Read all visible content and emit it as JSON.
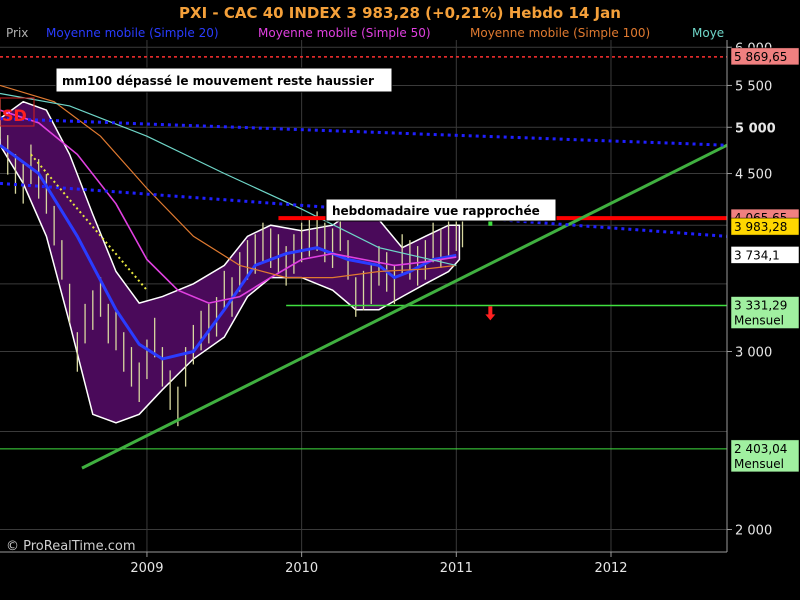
{
  "header": {
    "title": "PXI - CAC 40 INDEX     3 983,28 (+0,21%)     Hebdo  14 Jan"
  },
  "legend": [
    {
      "label": "Prix",
      "color": "#b0b0b0"
    },
    {
      "label": "Moyenne mobile (Simple 20)",
      "color": "#2a3cff"
    },
    {
      "label": "Moyenne mobile (Simple 50)",
      "color": "#e040e0"
    },
    {
      "label": "Moyenne mobile (Simple 100)",
      "color": "#e07a30"
    },
    {
      "label": "Moye",
      "color": "#6fd6c8"
    }
  ],
  "annotations": [
    {
      "text": "mm100 dépassé  le mouvement reste haussier"
    },
    {
      "text": "hebdomadaire vue rapprochée"
    }
  ],
  "price_tags": [
    {
      "label": "5 869,65",
      "value": 5869.65,
      "bg": "#f08080"
    },
    {
      "label": "4 065,65",
      "value": 4065.65,
      "bg": "#f08080"
    },
    {
      "label": "3 983,28",
      "value": 3983.28,
      "bg": "#ffd700"
    },
    {
      "label": "3 734,1",
      "value": 3734.1,
      "bg": "#ffffff"
    },
    {
      "label": "3 331,29",
      "value": 3331.29,
      "bg": "#a0f0a0",
      "sub": "Mensuel"
    },
    {
      "label": "2 403,04",
      "value": 2403.04,
      "bg": "#a0f0a0",
      "sub": "Mensuel"
    }
  ],
  "badge": "SD",
  "credit": "© ProRealTime.com",
  "colors": {
    "background": "#000000",
    "grid": "#3a3a3a",
    "band_fill": "#4a0a5a",
    "band_edge": "#ffffff",
    "ma20": "#2a3cff",
    "ma50": "#e040e0",
    "ma100": "#e07a30",
    "ma_other": "#6fd6c8",
    "trendline": "#40b040",
    "resistance": "#ff0000",
    "support": "#40e040",
    "channel": "#2020ff"
  },
  "chart_data": {
    "type": "line",
    "title": "PXI - CAC 40 INDEX     3 983,28 (+0,21%)     Hebdo  14 Jan",
    "xlabel": "",
    "ylabel": "",
    "x_ticks": [
      "2009",
      "2010",
      "2011",
      "2012"
    ],
    "y_ticks": [
      {
        "value": 6000,
        "label": "6 000",
        "bold": false
      },
      {
        "value": 5500,
        "label": "5 500",
        "bold": false
      },
      {
        "value": 5000,
        "label": "5 000",
        "bold": true
      },
      {
        "value": 4500,
        "label": "4 500",
        "bold": false
      },
      {
        "value": 3000,
        "label": "3 000",
        "bold": false
      },
      {
        "value": 2000,
        "label": "2 000",
        "bold": false
      }
    ],
    "scale": "log",
    "ylim": [
      1900,
      6100
    ],
    "xlim": [
      2008.05,
      2012.75
    ],
    "grid": true,
    "legend_position": "top",
    "price_close": {
      "x": [
        2008.05,
        2008.1,
        2008.15,
        2008.2,
        2008.25,
        2008.3,
        2008.35,
        2008.4,
        2008.45,
        2008.5,
        2008.55,
        2008.6,
        2008.65,
        2008.7,
        2008.75,
        2008.8,
        2008.85,
        2008.9,
        2008.95,
        2009.0,
        2009.05,
        2009.1,
        2009.15,
        2009.2,
        2009.25,
        2009.3,
        2009.35,
        2009.4,
        2009.45,
        2009.5,
        2009.55,
        2009.6,
        2009.65,
        2009.7,
        2009.75,
        2009.8,
        2009.85,
        2009.9,
        2009.95,
        2010.0,
        2010.05,
        2010.1,
        2010.15,
        2010.2,
        2010.25,
        2010.3,
        2010.35,
        2010.4,
        2010.45,
        2010.5,
        2010.55,
        2010.6,
        2010.65,
        2010.7,
        2010.75,
        2010.8,
        2010.85,
        2010.9,
        2010.95,
        2011.0,
        2011.04
      ],
      "y": [
        5100,
        4700,
        4500,
        4400,
        4600,
        4450,
        4300,
        4000,
        3700,
        3350,
        3000,
        3200,
        3300,
        3400,
        3200,
        3150,
        3000,
        2900,
        2800,
        2950,
        3100,
        2900,
        2750,
        2650,
        2900,
        3050,
        3150,
        3200,
        3250,
        3450,
        3400,
        3600,
        3700,
        3750,
        3850,
        3800,
        3750,
        3650,
        3750,
        3850,
        3900,
        3950,
        3850,
        3800,
        3950,
        3700,
        3400,
        3450,
        3500,
        3650,
        3600,
        3500,
        3750,
        3700,
        3650,
        3700,
        3850,
        3800,
        3900,
        3950,
        3983.28
      ]
    },
    "series": [
      {
        "name": "Moyenne mobile (Simple 20)",
        "x": [
          2008.05,
          2008.3,
          2008.55,
          2008.8,
          2008.95,
          2009.1,
          2009.3,
          2009.5,
          2009.7,
          2009.9,
          2010.1,
          2010.3,
          2010.5,
          2010.6,
          2010.7,
          2010.85,
          2011.0
        ],
        "y": [
          4800,
          4500,
          3900,
          3300,
          3050,
          2950,
          3000,
          3300,
          3650,
          3750,
          3800,
          3700,
          3650,
          3550,
          3600,
          3700,
          3734.1
        ]
      },
      {
        "name": "Moyenne mobile (Simple 50)",
        "x": [
          2008.05,
          2008.3,
          2008.55,
          2008.8,
          2009.0,
          2009.2,
          2009.4,
          2009.6,
          2009.8,
          2010.0,
          2010.2,
          2010.4,
          2010.6,
          2010.8,
          2011.0
        ],
        "y": [
          5200,
          5050,
          4700,
          4200,
          3700,
          3450,
          3350,
          3400,
          3550,
          3700,
          3750,
          3700,
          3650,
          3680,
          3720
        ]
      },
      {
        "name": "Moyenne mobile (Simple 100)",
        "x": [
          2008.05,
          2008.4,
          2008.7,
          2009.0,
          2009.3,
          2009.6,
          2009.9,
          2010.2,
          2010.5,
          2010.8,
          2011.0
        ],
        "y": [
          5500,
          5300,
          4900,
          4350,
          3900,
          3650,
          3550,
          3550,
          3600,
          3620,
          3650
        ]
      },
      {
        "name": "Moye",
        "x": [
          2008.05,
          2008.5,
          2009.0,
          2009.5,
          2010.0,
          2010.5,
          2011.0
        ],
        "y": [
          5400,
          5250,
          4900,
          4500,
          4150,
          3800,
          3650
        ]
      }
    ],
    "band": {
      "upper": {
        "x": [
          2008.05,
          2008.2,
          2008.35,
          2008.5,
          2008.65,
          2008.8,
          2008.95,
          2009.1,
          2009.3,
          2009.5,
          2009.65,
          2009.8,
          2010.0,
          2010.2,
          2010.35,
          2010.5,
          2010.65,
          2010.8,
          2010.95,
          2011.02
        ],
        "y": [
          5100,
          5300,
          5200,
          4700,
          4100,
          3600,
          3350,
          3400,
          3500,
          3650,
          3900,
          4000,
          3950,
          4000,
          4150,
          4050,
          3800,
          3900,
          4000,
          4000
        ]
      },
      "lower": {
        "x": [
          2008.05,
          2008.2,
          2008.35,
          2008.5,
          2008.65,
          2008.8,
          2008.95,
          2009.1,
          2009.3,
          2009.5,
          2009.65,
          2009.8,
          2010.0,
          2010.2,
          2010.35,
          2010.5,
          2010.65,
          2010.8,
          2010.95,
          2011.02
        ],
        "y": [
          4800,
          4400,
          3900,
          3200,
          2600,
          2550,
          2600,
          2750,
          2950,
          3100,
          3400,
          3550,
          3550,
          3450,
          3300,
          3300,
          3400,
          3500,
          3600,
          3700
        ]
      }
    },
    "lines": [
      {
        "name": "resistance",
        "x": [
          2009.85,
          2012.75
        ],
        "y": [
          4065.65,
          4065.65
        ]
      },
      {
        "name": "support",
        "x": [
          2009.9,
          2012.75
        ],
        "y": [
          3331.29,
          3331.29
        ]
      },
      {
        "name": "support2",
        "x": [
          2008.05,
          2012.75
        ],
        "y": [
          2403.04,
          2403.04
        ]
      },
      {
        "name": "top",
        "x": [
          2008.05,
          2012.75
        ],
        "y": [
          5869.65,
          5869.65
        ]
      },
      {
        "name": "trendline",
        "x": [
          2008.58,
          2012.75
        ],
        "y": [
          2300,
          4800
        ]
      },
      {
        "name": "channel-upper",
        "x": [
          2008.05,
          2012.75
        ],
        "y": [
          5100,
          4800
        ]
      },
      {
        "name": "channel-lower",
        "x": [
          2008.05,
          2012.75
        ],
        "y": [
          4400,
          3900
        ]
      },
      {
        "name": "dotted-yellow",
        "x": [
          2008.25,
          2009.0
        ],
        "y": [
          4700,
          3450
        ]
      }
    ],
    "arrows": [
      {
        "name": "up-arrow",
        "x": 2011.22,
        "y": 4050,
        "dir": "up",
        "color": "#40e040"
      },
      {
        "name": "down-arrow",
        "x": 2011.22,
        "y": 3280,
        "dir": "down",
        "color": "#ff2020"
      }
    ]
  }
}
